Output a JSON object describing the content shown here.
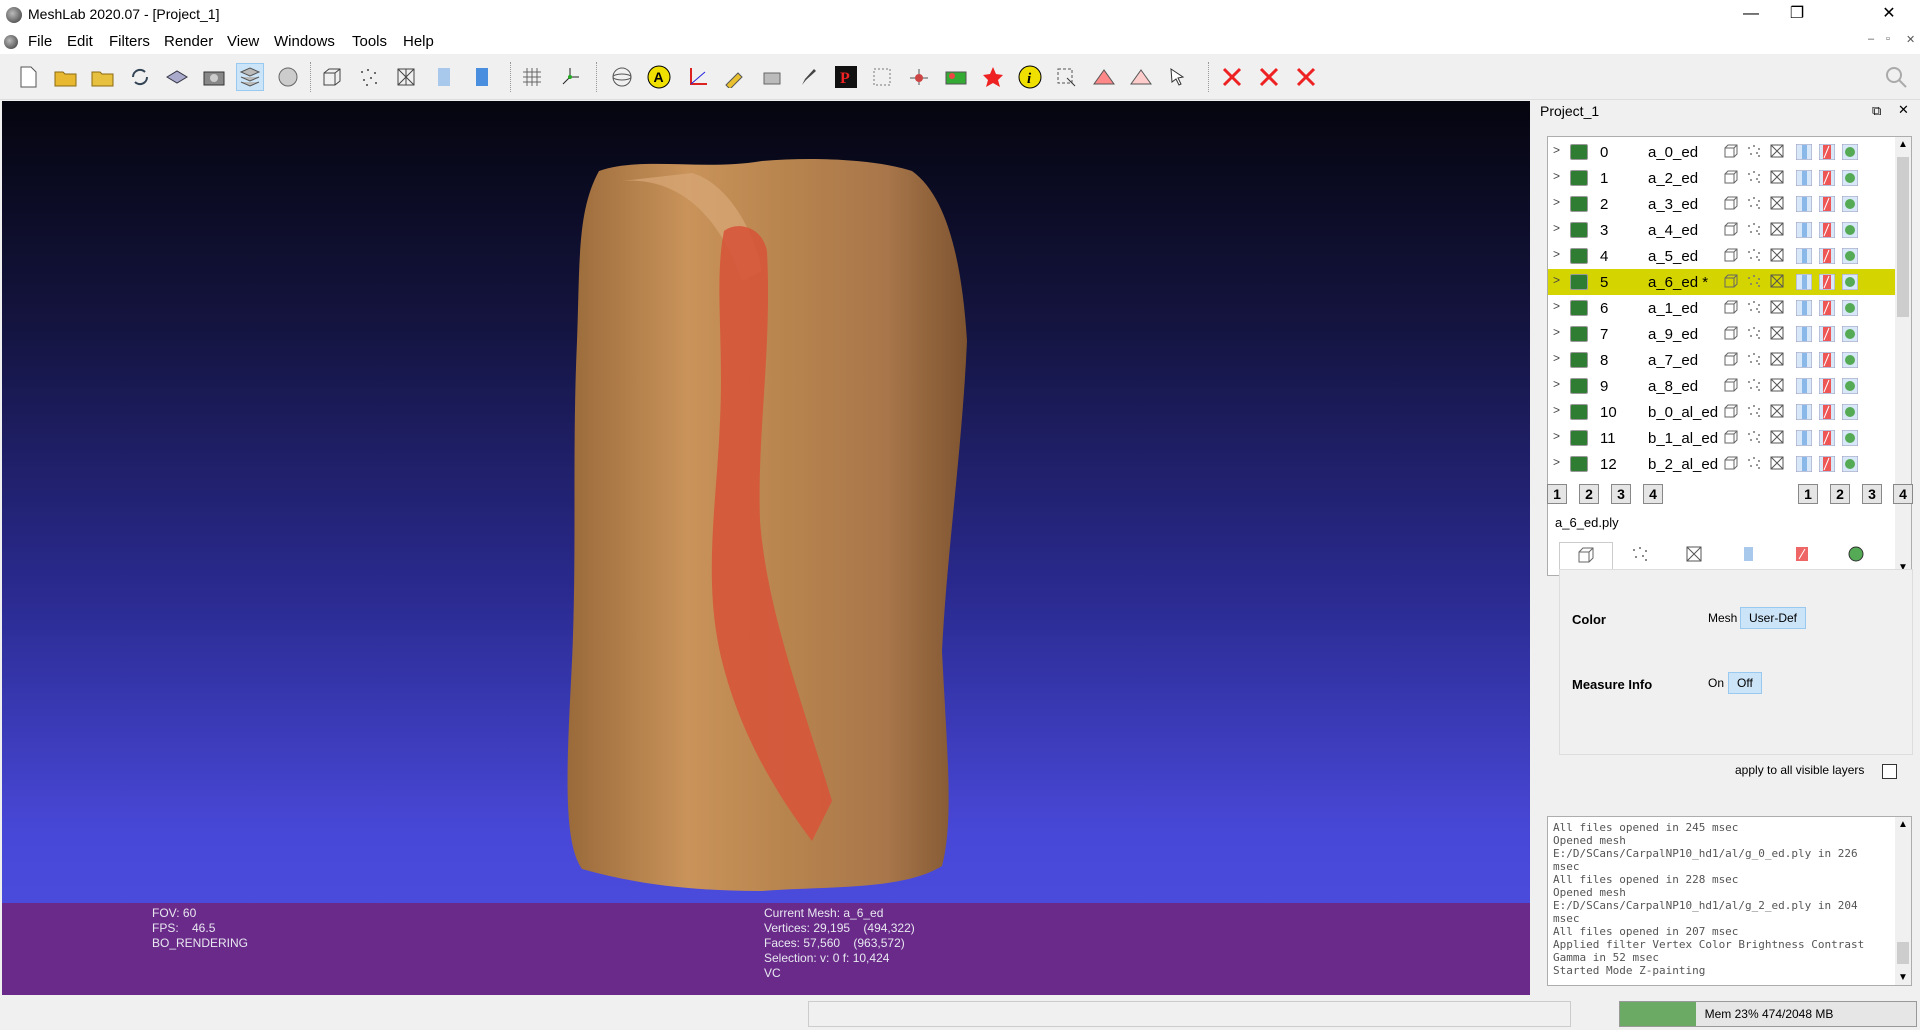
{
  "window": {
    "title": "MeshLab 2020.07 - [Project_1]",
    "minimize": "—",
    "restore": "❐",
    "close": "✕"
  },
  "menu": [
    "File",
    "Edit",
    "Filters",
    "Render",
    "View",
    "Windows",
    "Tools",
    "Help"
  ],
  "mdi": {
    "minimize": "–",
    "restore": "▫",
    "close": "✕"
  },
  "toolbar_icons": [
    "new-project-icon",
    "open-project-icon",
    "open-mesh-icon",
    "reload-icon",
    "save-icon",
    "snapshot-icon",
    "layers-icon",
    "global-icon",
    "bounding-box-icon",
    "points-icon",
    "wireframe-icon",
    "flat-icon",
    "smooth-icon",
    "grid-icon",
    "axis-icon",
    "trackball-icon",
    "annotation-icon",
    "measure-icon",
    "align-icon",
    "camera-icon",
    "paint-icon",
    "pick-points-icon",
    "select-vertices-icon",
    "manipulator-icon",
    "georef-icon",
    "color-icon",
    "info-icon",
    "select-faces-icon",
    "select-connected-icon",
    "select-area-icon",
    "select-cursor-icon",
    "delete-vertices-icon",
    "delete-faces-icon",
    "delete-all-icon"
  ],
  "viewport": {
    "left_info": "FOV: 60\nFPS:    46.5\nBO_RENDERING",
    "right_info": "Current Mesh: a_6_ed\nVertices: 29,195    (494,322)\nFaces: 57,560    (963,572)\nSelection: v: 0 f: 10,424\nVC"
  },
  "dock": {
    "title": "Project_1",
    "float": "⧉",
    "close": "✕"
  },
  "layers": [
    {
      "idx": "0",
      "name": "a_0_ed"
    },
    {
      "idx": "1",
      "name": "a_2_ed"
    },
    {
      "idx": "2",
      "name": "a_3_ed"
    },
    {
      "idx": "3",
      "name": "a_4_ed"
    },
    {
      "idx": "4",
      "name": "a_5_ed"
    },
    {
      "idx": "5",
      "name": "a_6_ed *",
      "selected": true
    },
    {
      "idx": "6",
      "name": "a_1_ed"
    },
    {
      "idx": "7",
      "name": "a_9_ed"
    },
    {
      "idx": "8",
      "name": "a_7_ed"
    },
    {
      "idx": "9",
      "name": "a_8_ed"
    },
    {
      "idx": "10",
      "name": "b_0_al_ed"
    },
    {
      "idx": "11",
      "name": "b_1_al_ed"
    },
    {
      "idx": "12",
      "name": "b_2_al_ed"
    }
  ],
  "num_buttons_left": [
    "1",
    "2",
    "3",
    "4"
  ],
  "num_buttons_right": [
    "1",
    "2",
    "3",
    "4"
  ],
  "mesh_file": "a_6_ed.ply",
  "props": {
    "color_label": "Color",
    "color_mesh": "Mesh",
    "color_userdef": "User-Def",
    "measure_label": "Measure Info",
    "measure_on": "On",
    "measure_off": "Off"
  },
  "apply_label": "apply to all visible layers",
  "log": "All files opened in 245 msec\nOpened mesh E:/D/SCans/CarpalNP10_hd1/al/g_0_ed.ply in 226 msec\nAll files opened in 228 msec\nOpened mesh E:/D/SCans/CarpalNP10_hd1/al/g_2_ed.ply in 204 msec\nAll files opened in 207 msec\nApplied filter Vertex Color Brightness Contrast Gamma in 52 msec\nStarted Mode Z-painting",
  "memory": {
    "text": "Mem 23% 474/2048 MB",
    "fraction": 0.23
  },
  "colors": {
    "selected_row": "#d4d400",
    "info_bar": "#6a2a8a",
    "mem_fill": "#6aaa64"
  }
}
